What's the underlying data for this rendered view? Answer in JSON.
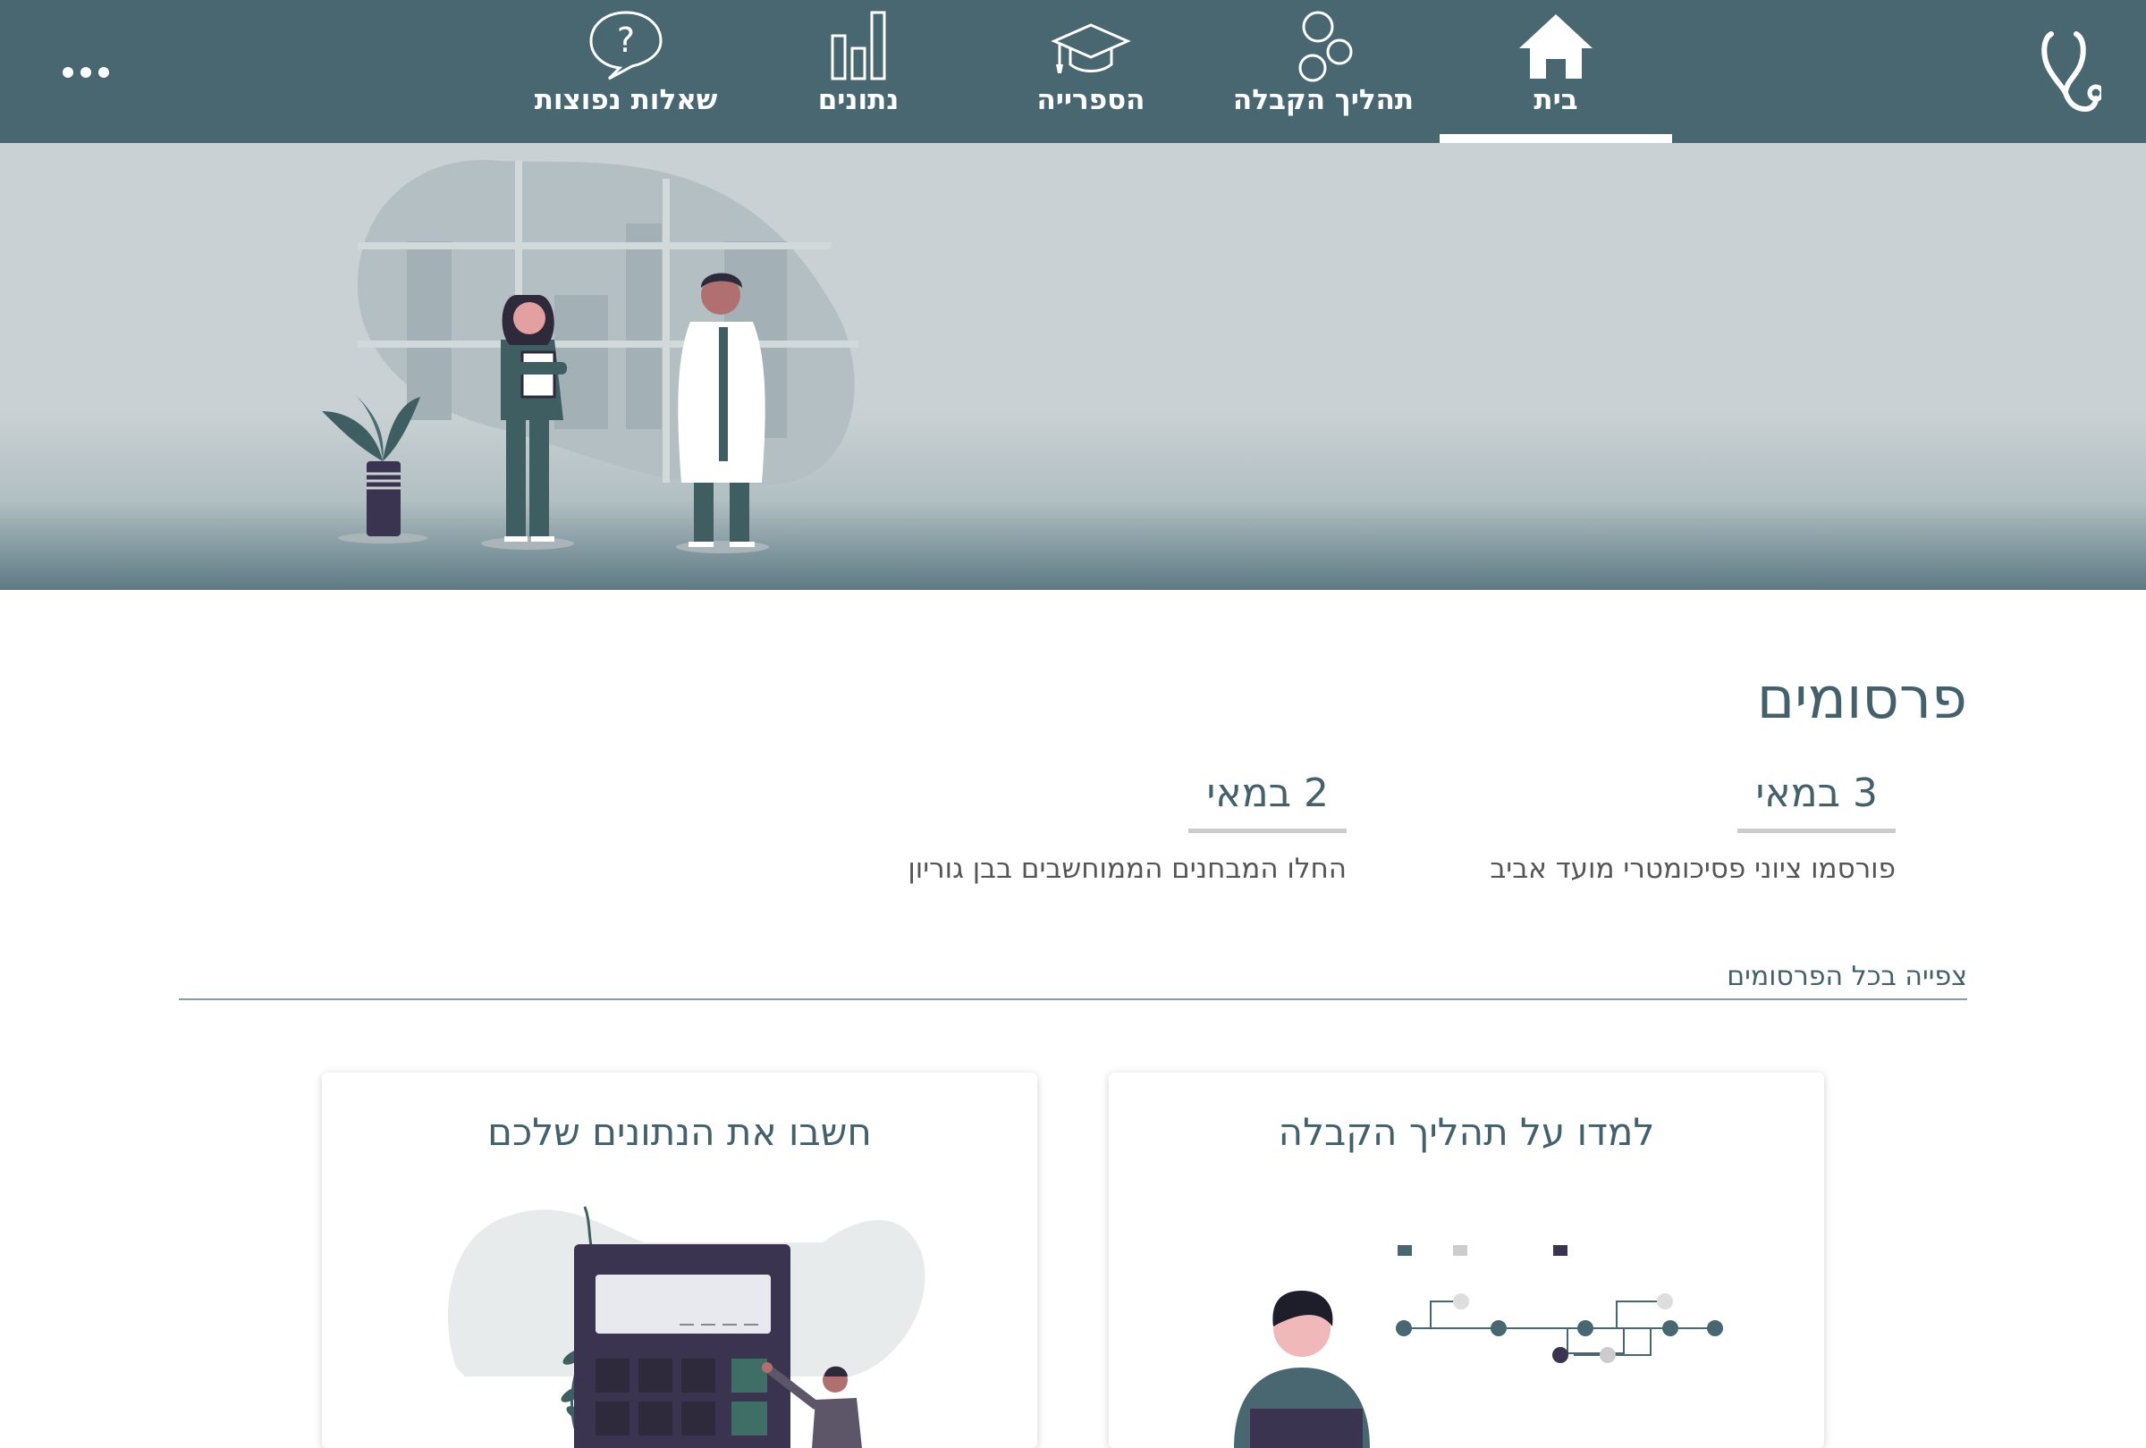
{
  "nav": {
    "items": [
      {
        "label": "בית",
        "icon": "home-icon",
        "active": true
      },
      {
        "label": "תהליך הקבלה",
        "icon": "circles-icon",
        "active": false
      },
      {
        "label": "הספרייה",
        "icon": "graduation-cap-icon",
        "active": false
      },
      {
        "label": "נתונים",
        "icon": "bar-chart-icon",
        "active": false
      },
      {
        "label": "שאלות נפוצות",
        "icon": "question-bubble-icon",
        "active": false
      }
    ],
    "more_icon": "more-dots-icon",
    "logo_icon": "stethoscope-icon"
  },
  "publications": {
    "title": "פרסומים",
    "items": [
      {
        "date": "3 במאי",
        "text": "פורסמו ציוני פסיכומטרי מועד אביב"
      },
      {
        "date": "2 במאי",
        "text": "החלו המבחנים הממוחשבים בבן גוריון"
      }
    ],
    "view_all": "צפייה בכל הפרסומים"
  },
  "cards": [
    {
      "title": "למדו על תהליך הקבלה"
    },
    {
      "title": "חשבו את הנתונים שלכם"
    }
  ],
  "colors": {
    "nav_bg": "#496771",
    "accent": "#44606b",
    "hero_bg": "#c9d1d4"
  }
}
